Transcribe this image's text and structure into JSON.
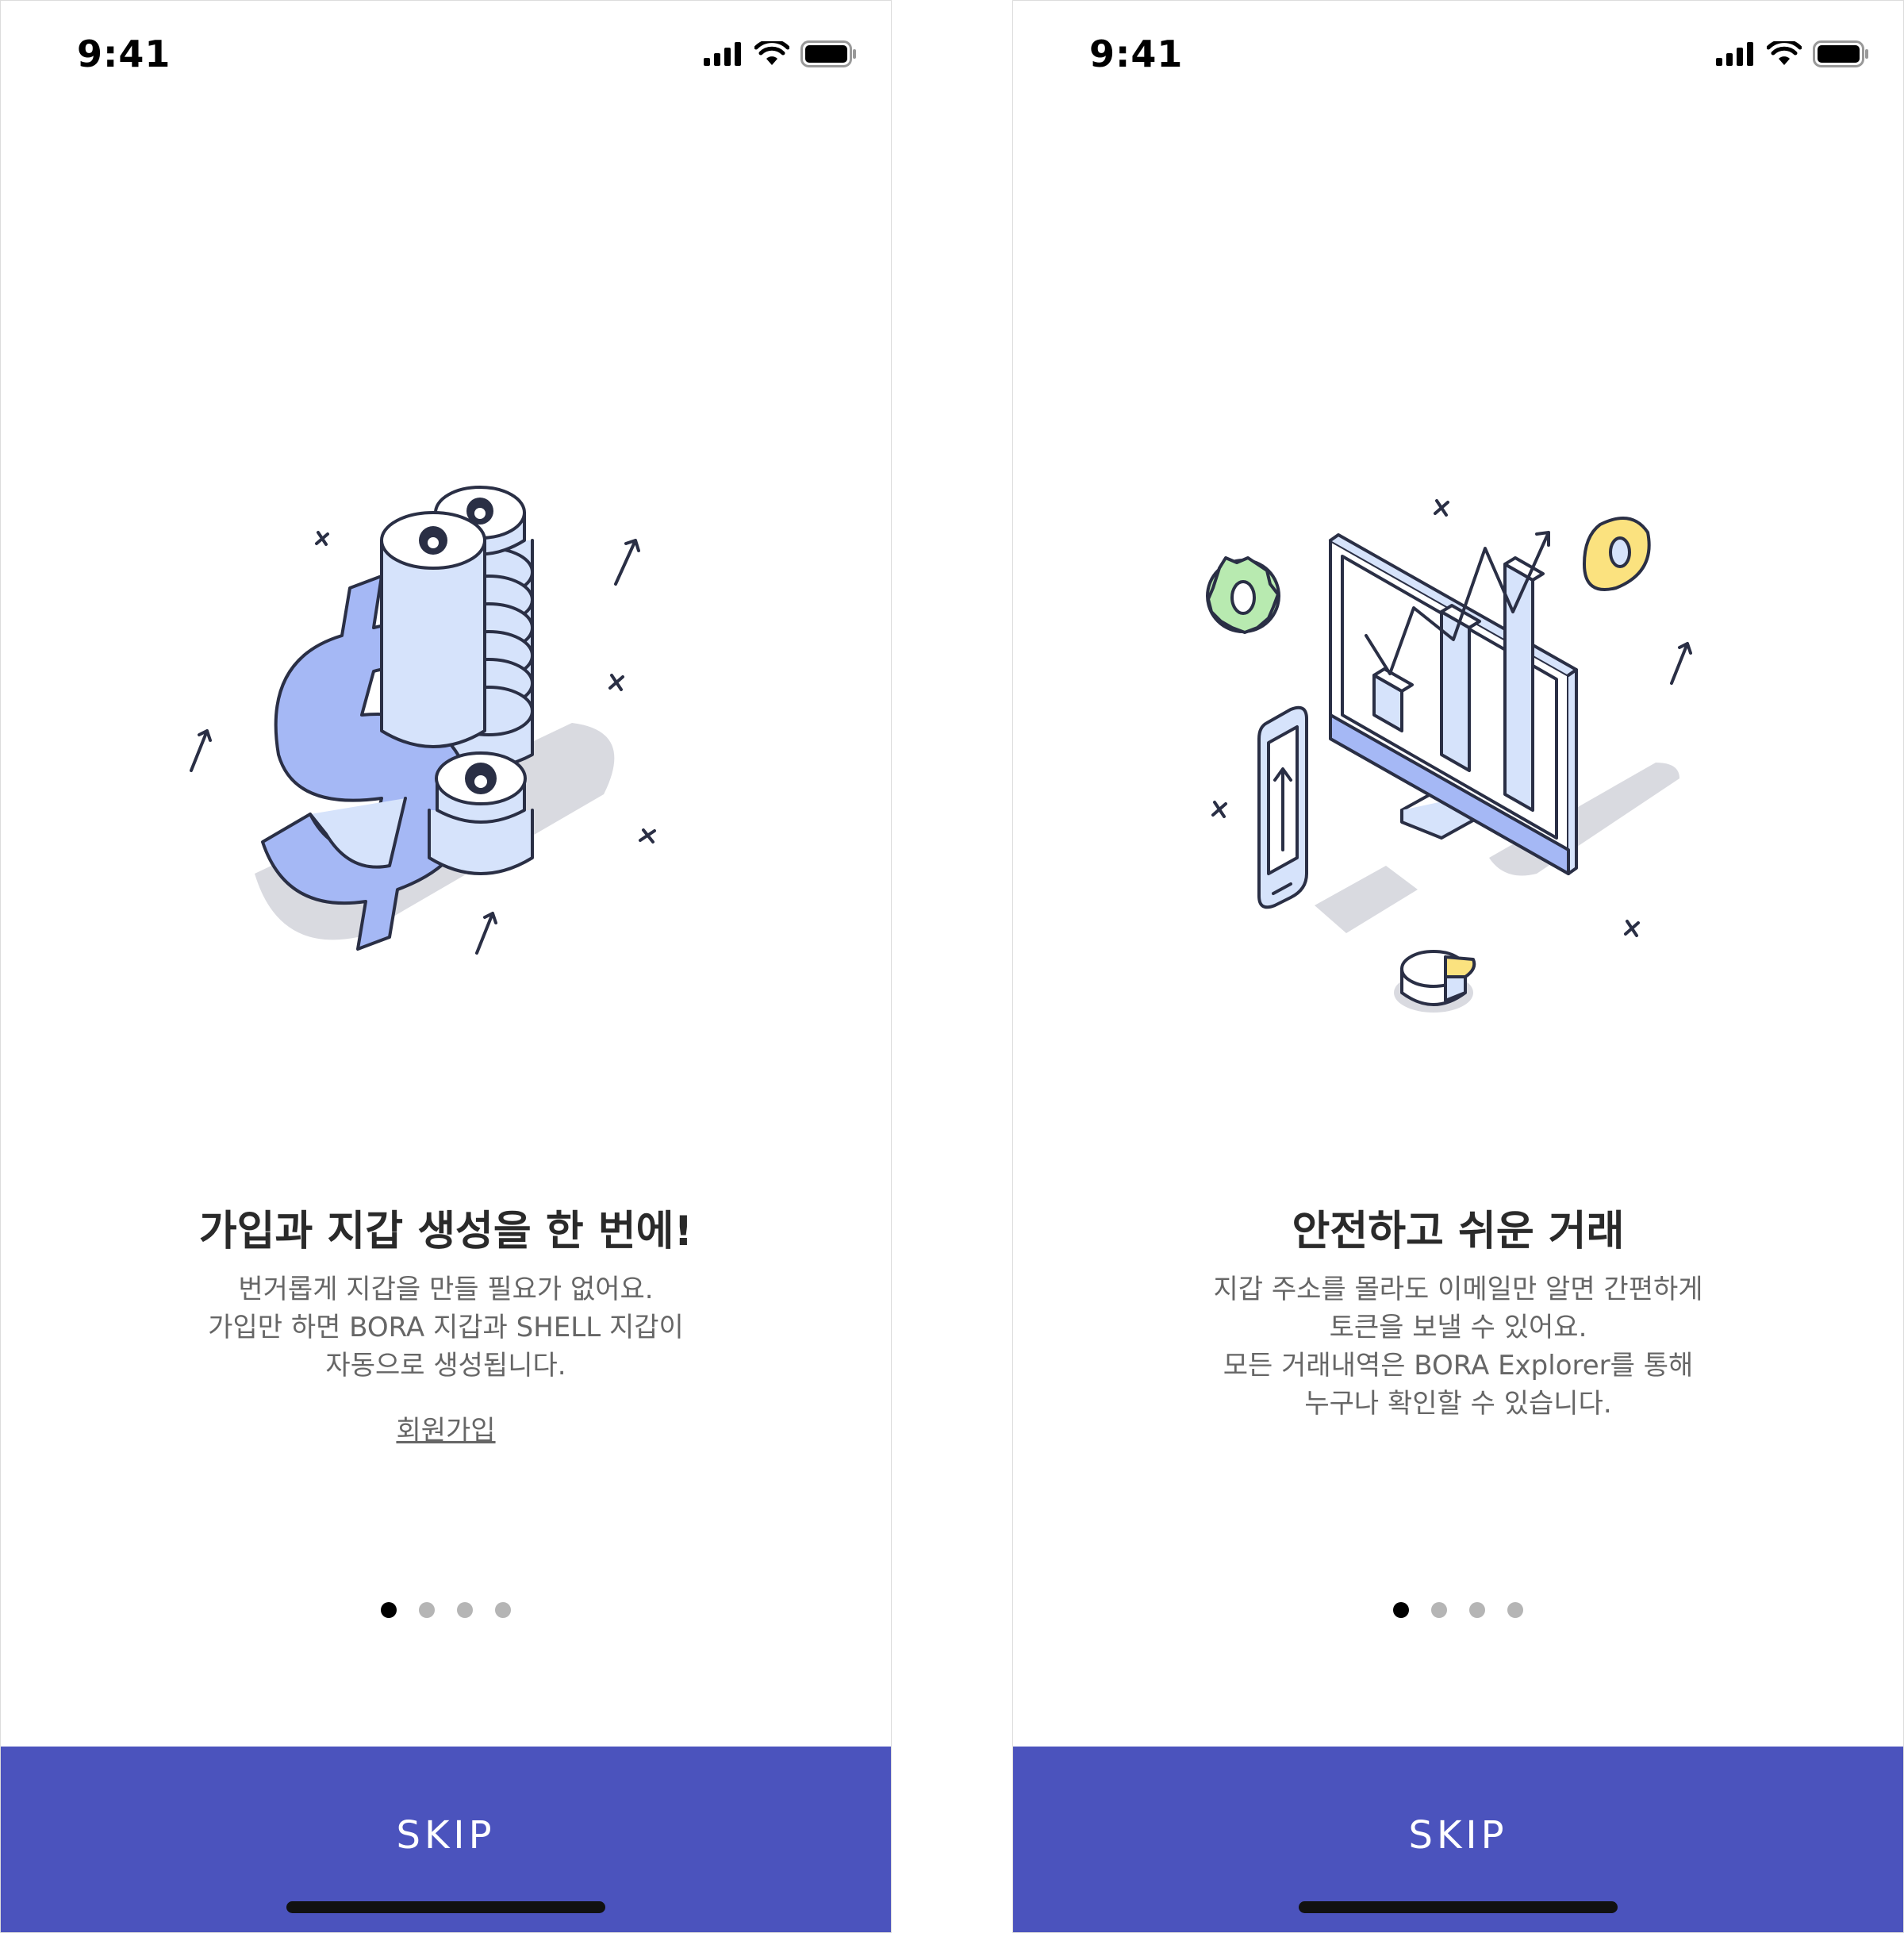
{
  "colors": {
    "accent": "#4b53bd",
    "illustration_blue": "#a5b8f5",
    "illustration_lightblue": "#d6e3fb",
    "outline": "#2a2f45",
    "yellow": "#fbe27f",
    "green": "#b8eab0"
  },
  "screens": [
    {
      "status_time": "9:41",
      "title": "가입과 지갑 생성을 한 번에!",
      "description": [
        "번거롭게 지갑을 만들 필요가 없어요.",
        "가입만 하면 BORA 지갑과 SHELL 지갑이",
        "자동으로 생성됩니다."
      ],
      "signup_link": "회원가입",
      "illustration": "coins-dollar-illustration",
      "page_count": 4,
      "active_page": 1,
      "skip_label": "SKIP"
    },
    {
      "status_time": "9:41",
      "title": "안전하고 쉬운 거래",
      "description": [
        "지갑 주소를 몰라도 이메일만 알면 간편하게",
        "토큰을 보낼 수 있어요.",
        "모든 거래내역은 BORA Explorer를 통해",
        "누구나 확인할 수 있습니다."
      ],
      "illustration": "monitor-chart-illustration",
      "page_count": 4,
      "active_page": 1,
      "skip_label": "SKIP"
    }
  ]
}
